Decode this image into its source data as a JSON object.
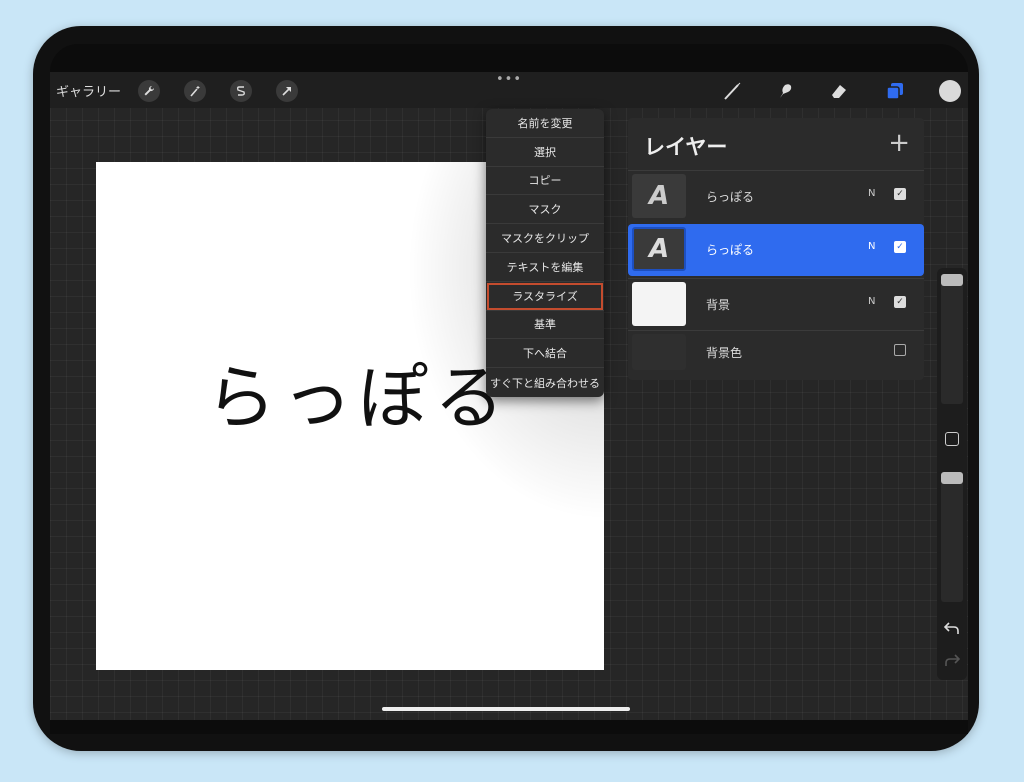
{
  "toolbar": {
    "gallery_label": "ギャラリー",
    "dots": "•••",
    "left_icons": [
      "wrench-icon",
      "magic-wand-icon",
      "selection-s-icon",
      "arrow-icon"
    ],
    "right_icons": [
      "brush-icon",
      "smudge-icon",
      "eraser-icon",
      "layers-icon",
      "color-swatch-icon"
    ]
  },
  "canvas": {
    "text": "らっぽる"
  },
  "context_menu": {
    "items": [
      "名前を変更",
      "選択",
      "コピー",
      "マスク",
      "マスクをクリップ",
      "テキストを編集",
      "ラスタライズ",
      "基準",
      "下へ結合",
      "すぐ下と組み合わせる"
    ],
    "highlighted": "ラスタライズ"
  },
  "layers_panel": {
    "title": "レイヤー",
    "add_symbol": "+",
    "layers": [
      {
        "name": "らっぽる",
        "mode": "N",
        "visible": true,
        "thumb": "A",
        "selected": false
      },
      {
        "name": "らっぽる",
        "mode": "N",
        "visible": true,
        "thumb": "A",
        "selected": true
      },
      {
        "name": "背景",
        "mode": "N",
        "visible": true,
        "thumb": "",
        "selected": false
      },
      {
        "name": "背景色",
        "mode": "",
        "visible": false,
        "thumb": "",
        "selected": false
      }
    ]
  },
  "sidebar": {
    "icons": [
      "square-modify-icon",
      "undo-icon",
      "redo-icon"
    ]
  },
  "colors": {
    "accent": "#2f6bef",
    "highlight_outline": "#c44c2e",
    "color_swatch": "#d9d9d9"
  }
}
